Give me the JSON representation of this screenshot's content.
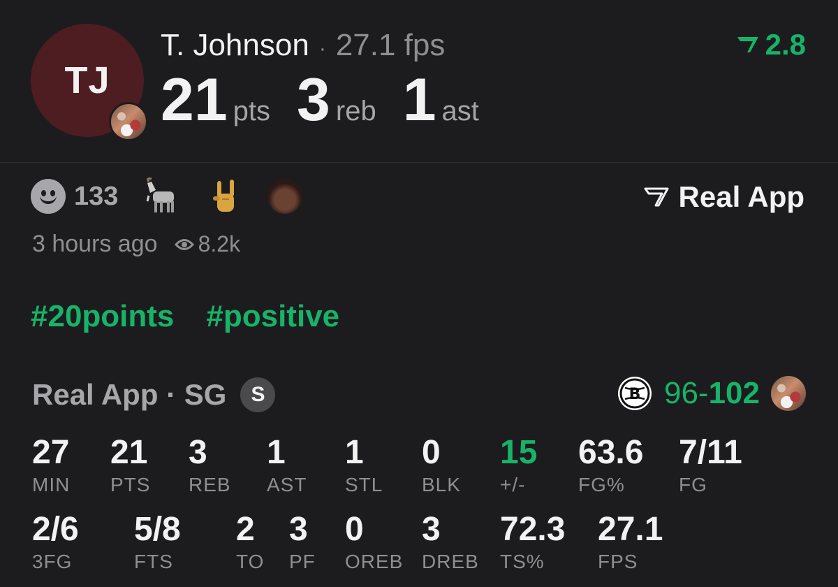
{
  "header": {
    "initials": "TJ",
    "player_name": "T. Johnson",
    "separator": "·",
    "fps": "27.1 fps",
    "points": "21",
    "points_unit": "pts",
    "rebounds": "3",
    "rebounds_unit": "reb",
    "assists": "1",
    "assists_unit": "ast",
    "score_change": "2.8"
  },
  "reactions": {
    "count": "133",
    "emojis": [
      "goat-emoji",
      "rock-on-hand-emoji",
      "face-emoji"
    ]
  },
  "brand": {
    "label": "Real App"
  },
  "meta": {
    "time": "3 hours ago",
    "views": "8.2k"
  },
  "tags": [
    "#20points",
    "#positive"
  ],
  "game": {
    "source": "Real App",
    "separator": " · ",
    "position": "SG",
    "starter_badge": "S",
    "score_team": "96",
    "score_dash": "-",
    "score_opp": "102"
  },
  "box_score": {
    "row1": [
      {
        "value": "27",
        "label": "MIN"
      },
      {
        "value": "21",
        "label": "PTS"
      },
      {
        "value": "3",
        "label": "REB"
      },
      {
        "value": "1",
        "label": "AST"
      },
      {
        "value": "1",
        "label": "STL"
      },
      {
        "value": "0",
        "label": "BLK"
      },
      {
        "value": "15",
        "label": "+/-"
      },
      {
        "value": "63.6",
        "label": "FG%"
      },
      {
        "value": "7/11",
        "label": "FG"
      }
    ],
    "row2": [
      {
        "value": "2/6",
        "label": "3FG"
      },
      {
        "value": "5/8",
        "label": "FTS"
      },
      {
        "value": "2",
        "label": "TO"
      },
      {
        "value": "3",
        "label": "PF"
      },
      {
        "value": "0",
        "label": "OREB"
      },
      {
        "value": "3",
        "label": "DREB"
      },
      {
        "value": "72.3",
        "label": "TS%"
      },
      {
        "value": "27.1",
        "label": "FPS"
      }
    ]
  },
  "colors": {
    "background": "#1c1c1e",
    "accent_green": "#17b368",
    "avatar_bg": "#4e1d22",
    "muted": "#8e8e93"
  }
}
